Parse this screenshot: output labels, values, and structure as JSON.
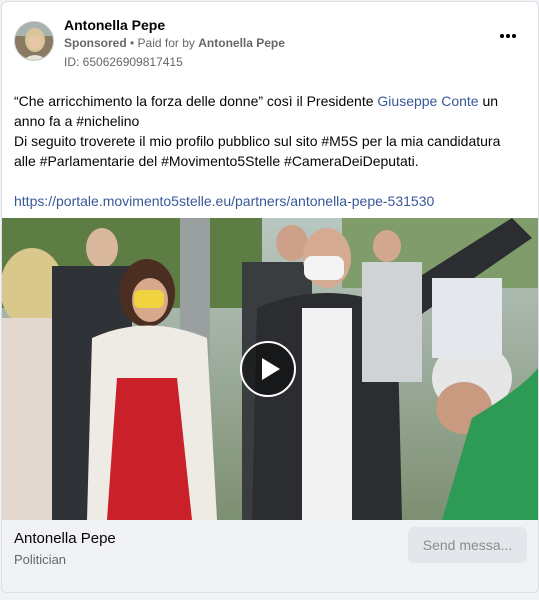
{
  "post": {
    "author": "Antonella Pepe",
    "sponsored_label": "Sponsored",
    "paid_for_prefix": " • Paid for by ",
    "paid_for_name": "Antonella Pepe",
    "ad_id": "ID: 650626909817415",
    "text_line1_before": "“Che arricchimento la forza delle donne” così il Presidente ",
    "text_line1_link": "Giuseppe Conte",
    "text_line1_after": " un anno fa a #nichelino",
    "text_line2": "Di seguito troverete il mio profilo pubblico sul sito #M5S per la mia candidatura alle #Parlamentarie del #Movimento5Stelle #CameraDeiDeputati.",
    "url": "https://portale.movimento5stelle.eu/partners/antonella-pepe-531530"
  },
  "footer": {
    "page_name": "Antonella Pepe",
    "page_category": "Politician",
    "send_button": "Send messa..."
  },
  "icons": {
    "more": "more-horizontal-icon",
    "play": "play-icon"
  },
  "colors": {
    "link": "#385898",
    "footer_bg": "#f0f2f5",
    "button_bg": "#e4e6eb"
  }
}
